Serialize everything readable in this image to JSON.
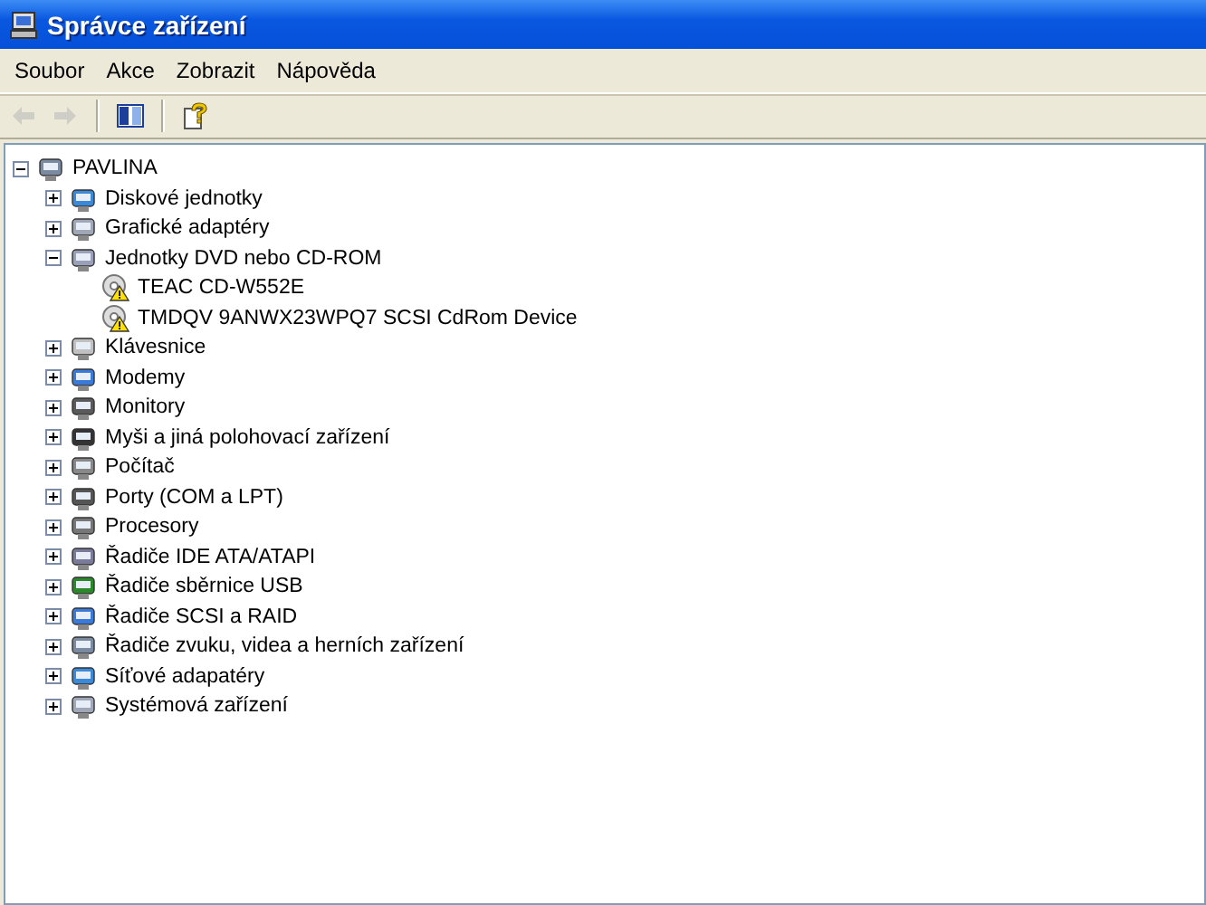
{
  "window": {
    "title": "Správce zařízení"
  },
  "menu": [
    "Soubor",
    "Akce",
    "Zobrazit",
    "Nápověda"
  ],
  "toolbar": [
    {
      "kind": "back",
      "disabled": true
    },
    {
      "kind": "forward",
      "disabled": true
    },
    {
      "kind": "panel",
      "disabled": false
    },
    {
      "kind": "help",
      "disabled": false
    }
  ],
  "tree": [
    {
      "label": "PAVLINA",
      "expanded": true,
      "children": [
        {
          "label": "Diskové jednotky",
          "expanded": false
        },
        {
          "label": "Grafické adaptéry",
          "expanded": false
        },
        {
          "label": "Jednotky DVD nebo CD-ROM",
          "expanded": true,
          "children": [
            {
              "label": "TEAC CD-W552E",
              "warning": true
            },
            {
              "label": "TMDQV 9ANWX23WPQ7 SCSI CdRom Device",
              "warning": true
            }
          ]
        },
        {
          "label": "Klávesnice",
          "expanded": false
        },
        {
          "label": "Modemy",
          "expanded": false
        },
        {
          "label": "Monitory",
          "expanded": false
        },
        {
          "label": "Myši a jiná polohovací zařízení",
          "expanded": false
        },
        {
          "label": "Počítač",
          "expanded": false
        },
        {
          "label": "Porty (COM a LPT)",
          "expanded": false
        },
        {
          "label": "Procesory",
          "expanded": false
        },
        {
          "label": "Řadiče IDE ATA/ATAPI",
          "expanded": false
        },
        {
          "label": "Řadiče sběrnice USB",
          "expanded": false
        },
        {
          "label": "Řadiče SCSI a RAID",
          "expanded": false
        },
        {
          "label": "Řadiče zvuku, videa a herních zařízení",
          "expanded": false
        },
        {
          "label": "Síťové adapatéry",
          "expanded": false
        },
        {
          "label": "Systémová zařízení",
          "expanded": false
        }
      ]
    }
  ]
}
